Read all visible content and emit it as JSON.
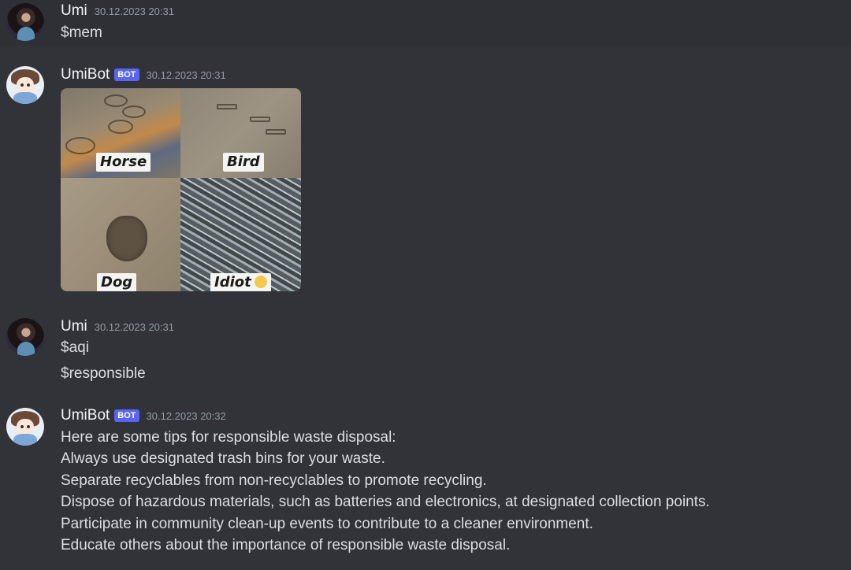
{
  "messages": [
    {
      "username": "Umi",
      "timestamp": "30.12.2023 20:31",
      "lines": [
        "$mem"
      ]
    },
    {
      "username": "UmiBot",
      "badge": "BOT",
      "timestamp": "30.12.2023 20:31",
      "attachment": {
        "panels": [
          "Horse",
          "Bird",
          "Dog",
          "Idiot"
        ]
      }
    },
    {
      "username": "Umi",
      "timestamp": "30.12.2023 20:31",
      "lines": [
        "$aqi",
        "$responsible"
      ]
    },
    {
      "username": "UmiBot",
      "badge": "BOT",
      "timestamp": "30.12.2023 20:32",
      "lines": [
        "Here are some tips for responsible waste disposal:",
        "Always use designated trash bins for your waste.",
        "Separate recyclables from non-recyclables to promote recycling.",
        "Dispose of hazardous materials, such as batteries and electronics, at designated collection points.",
        "Participate in community clean-up events to contribute to a cleaner environment.",
        "Educate others about the importance of responsible waste disposal."
      ]
    }
  ],
  "icons": {
    "toolbar": [
      "add-reaction-icon",
      "more-icon"
    ],
    "emoji": "grinning-face-icon"
  },
  "colors": {
    "background": "#313338",
    "bot_badge": "#5865f2",
    "text": "#dbdee1",
    "timestamp": "#949ba4"
  }
}
